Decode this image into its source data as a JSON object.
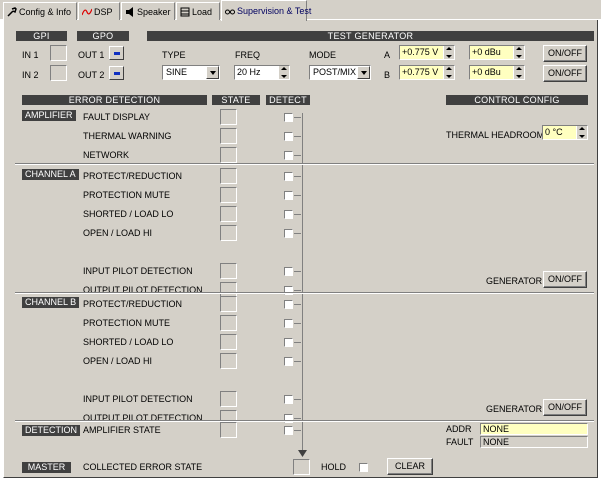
{
  "tabs": [
    {
      "label": "Config & Info",
      "icon": "wrench-icon"
    },
    {
      "label": "DSP",
      "icon": "dsp-curve-icon"
    },
    {
      "label": "Speaker",
      "icon": "speaker-icon"
    },
    {
      "label": "Load",
      "icon": "load-icon"
    },
    {
      "label": "Supervision & Test",
      "icon": "glasses-icon",
      "active": true
    }
  ],
  "gpi": {
    "header": "GPI",
    "in1": "IN 1",
    "in2": "IN 2"
  },
  "gpo": {
    "header": "GPO",
    "out1": "OUT 1",
    "out2": "OUT 2"
  },
  "generator": {
    "header": "TEST GENERATOR",
    "type_label": "TYPE",
    "type_value": "SINE",
    "freq_label": "FREQ",
    "freq_value": "20 Hz",
    "mode_label": "MODE",
    "mode_value": "POST/MIX",
    "a_label": "A",
    "b_label": "B",
    "a_level_v": "+0.775 V",
    "a_level_dbu": "+0 dBu",
    "b_level_v": "+0.775 V",
    "b_level_dbu": "+0 dBu",
    "onoff": "ON/OFF"
  },
  "error_detection": {
    "header": "ERROR DETECTION",
    "state_header": "STATE",
    "detect_header": "DETECT",
    "sections": {
      "amplifier": "AMPLIFIER",
      "channel_a": "CHANNEL A",
      "channel_b": "CHANNEL B",
      "detection": "DETECTION",
      "master": "MASTER"
    },
    "amp_rows": [
      "FAULT DISPLAY",
      "THERMAL WARNING",
      "NETWORK"
    ],
    "ch_rows": [
      "PROTECT/REDUCTION",
      "PROTECTION MUTE",
      "SHORTED / LOAD LO",
      "OPEN / LOAD HI",
      "INPUT PILOT DETECTION",
      "OUTPUT PILOT DETECTION"
    ],
    "detection_row": "AMPLIFIER STATE",
    "master_row": "COLLECTED ERROR STATE",
    "hold": "HOLD",
    "clear": "CLEAR"
  },
  "control_config": {
    "header": "CONTROL CONFIG",
    "thermal_headroom_label": "THERMAL HEADROOM",
    "thermal_headroom_value": "0 °C",
    "generator_label": "GENERATOR",
    "generator_onoff": "ON/OFF",
    "addr_label": "ADDR",
    "addr_value": "NONE",
    "fault_label": "FAULT",
    "fault_value": "NONE"
  },
  "colors": {
    "header_bg": "#404040",
    "panel_bg": "#d4d0c8",
    "field_yellow": "#ffffc0",
    "gpo_blue": "#1030c0"
  }
}
